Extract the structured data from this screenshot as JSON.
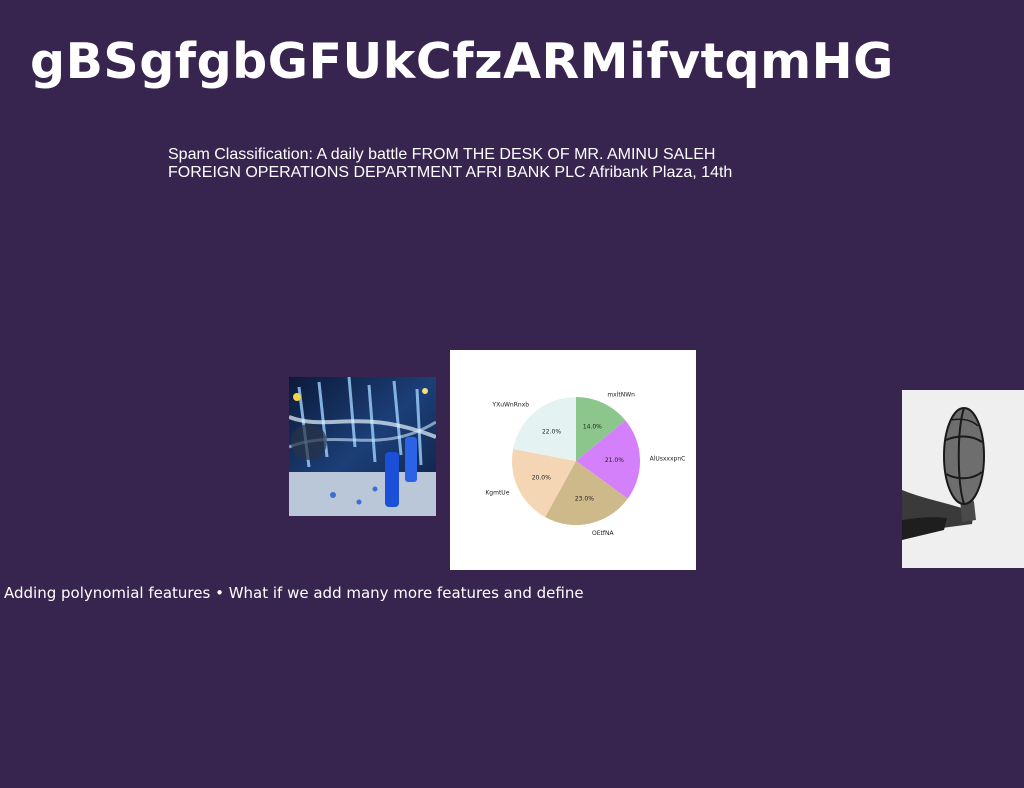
{
  "slide": {
    "title": "gBSgfgbGFUkCfzARMifvtqmHG",
    "body_line1": "Spam Classification: A daily battle FROM THE DESK OF MR. AMINU SALEH",
    "body_line2": "FOREIGN OPERATIONS DEPARTMENT AFRI BANK PLC Afribank Plaza, 14th",
    "caption": "Adding polynomial features • What if we add many more features and define"
  },
  "images": {
    "left_photo": "party-glasses-photo",
    "right_photo": "hand-holding-basketball-photo"
  },
  "chart_data": {
    "type": "pie",
    "title": "",
    "categories": [
      "mxltNWn",
      "AlUsxxxpnC",
      "OEtfNA",
      "KgmtUe",
      "YXuWnRnxb"
    ],
    "values": [
      14.0,
      21.0,
      23.0,
      20.0,
      22.0
    ],
    "labels": [
      "14.0%",
      "21.0%",
      "23.0%",
      "20.0%",
      "22.0%"
    ],
    "colors": [
      "#8cc68c",
      "#d580fb",
      "#cdb98a",
      "#f4d6b4",
      "#e4f3f1"
    ],
    "start_angle_deg": 90,
    "direction": "clockwise",
    "legend": "none"
  }
}
